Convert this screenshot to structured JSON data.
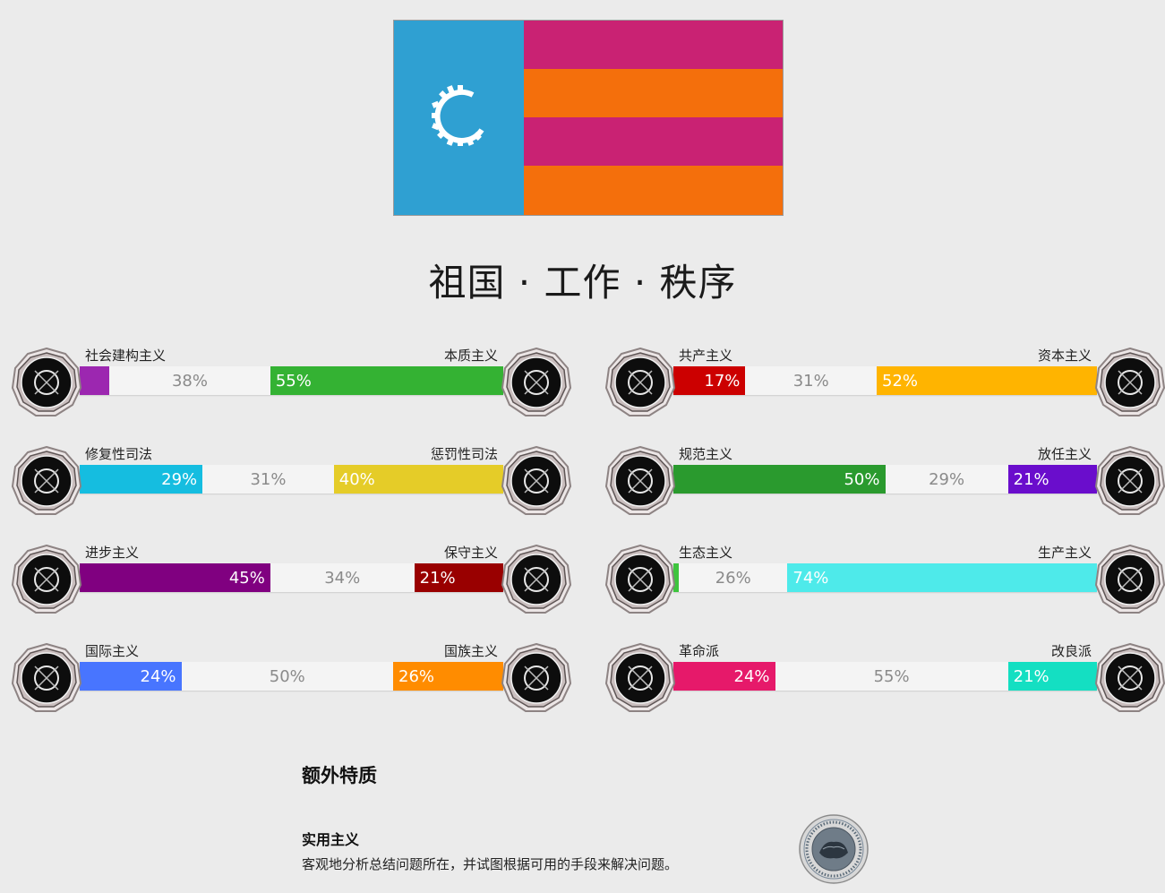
{
  "flag": {
    "hoist_color": "#2fa0d2",
    "stripe_colors": [
      "#c92273",
      "#f46f0c",
      "#c92273",
      "#f46f0c"
    ],
    "emblem": "gear-emblem-icon"
  },
  "motto": "祖国 · 工作 · 秩序",
  "axes": [
    {
      "left": "社会建构主义",
      "right": "本质主义",
      "left_pct": "",
      "center_pct": "38%",
      "right_pct": "55%",
      "values": [
        7,
        38,
        55
      ],
      "left_color": "#9c27b0",
      "right_color": "#34b233",
      "left_icon": "eye-icon",
      "right_icon": "flower-icon"
    },
    {
      "left": "共产主义",
      "right": "资本主义",
      "left_pct": "17%",
      "center_pct": "31%",
      "right_pct": "52%",
      "values": [
        17,
        31,
        52
      ],
      "left_color": "#cc0000",
      "right_color": "#ffb400",
      "left_icon": "hammer-sickle-icon",
      "right_icon": "money-bag-icon"
    },
    {
      "left": "修复性司法",
      "right": "惩罚性司法",
      "left_pct": "29%",
      "center_pct": "31%",
      "right_pct": "40%",
      "values": [
        29,
        31,
        40
      ],
      "left_color": "#15bde0",
      "right_color": "#e5cc28",
      "left_icon": "handshake-icon",
      "right_icon": "prison-bars-icon"
    },
    {
      "left": "规范主义",
      "right": "放任主义",
      "left_pct": "50%",
      "center_pct": "29%",
      "right_pct": "21%",
      "values": [
        50,
        29,
        21
      ],
      "left_color": "#2a9a2e",
      "right_color": "#6a0dcc",
      "left_icon": "ruler-icon",
      "right_icon": "butterfly-icon"
    },
    {
      "left": "进步主义",
      "right": "保守主义",
      "left_pct": "45%",
      "center_pct": "34%",
      "right_pct": "21%",
      "values": [
        45,
        34,
        21
      ],
      "left_color": "#800080",
      "right_color": "#990000",
      "left_icon": "rocket-icon",
      "right_icon": "quill-icon"
    },
    {
      "left": "生态主义",
      "right": "生产主义",
      "left_pct": "",
      "center_pct": "26%",
      "right_pct": "74%",
      "values": [
        0,
        26,
        74
      ],
      "left_color": "#3ec43e",
      "right_color": "#4eeaea",
      "left_icon": "leaf-icon",
      "right_icon": "gear-icon"
    },
    {
      "left": "国际主义",
      "right": "国族主义",
      "left_pct": "24%",
      "center_pct": "50%",
      "right_pct": "26%",
      "values": [
        24,
        50,
        26
      ],
      "left_color": "#4875ff",
      "right_color": "#ff8c00",
      "left_icon": "globe-icon",
      "right_icon": "flag-icon"
    },
    {
      "left": "革命派",
      "right": "改良派",
      "left_pct": "24%",
      "center_pct": "55%",
      "right_pct": "21%",
      "values": [
        24,
        55,
        21
      ],
      "left_color": "#e6196a",
      "right_color": "#14dfc2",
      "left_icon": "fist-icon",
      "right_icon": "scales-icon"
    }
  ],
  "extra": {
    "title": "额外特质",
    "trait_name": "实用主义",
    "trait_desc": "客观地分析总结问题所在，并试图根据可用的手段来解决问题。",
    "trait_icon": "pragmatism-seal-icon"
  }
}
